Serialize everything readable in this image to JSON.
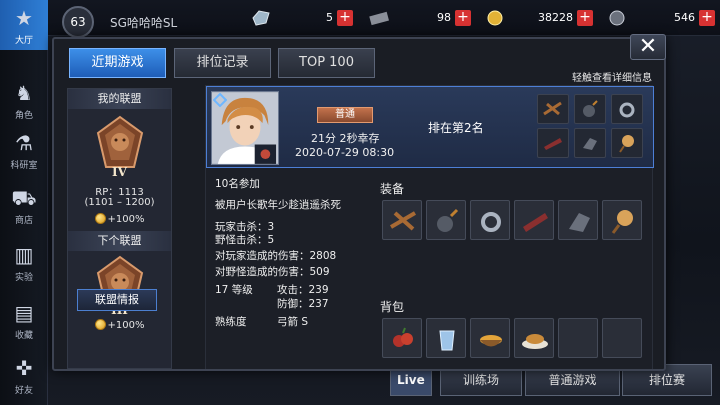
{
  "topbar": {
    "level": "63",
    "player_name": "SG哈哈哈SL",
    "resources": [
      {
        "icon": "diamond-icon",
        "amount": "5"
      },
      {
        "icon": "ticket-icon",
        "amount": "98"
      },
      {
        "icon": "gold-coin-icon",
        "amount": "38228"
      },
      {
        "icon": "bp-coin-icon",
        "amount": "546"
      }
    ],
    "plus": "+"
  },
  "sidebar": {
    "items": [
      {
        "label": "大厅",
        "icon": "star-icon"
      },
      {
        "label": "角色",
        "icon": "character-icon"
      },
      {
        "label": "科研室",
        "icon": "flask-icon"
      },
      {
        "label": "商店",
        "icon": "cart-icon"
      },
      {
        "label": "实验",
        "icon": "books-icon"
      },
      {
        "label": "收藏",
        "icon": "book-icon"
      },
      {
        "label": "好友",
        "icon": "gamepad-icon"
      }
    ]
  },
  "bottom": {
    "live": "Live",
    "training": "训练场",
    "normal_game": "普通游戏",
    "ranked": "排位赛"
  },
  "modal": {
    "tabs": [
      "近期游戏",
      "排位记录",
      "TOP 100"
    ],
    "active_tab": 0,
    "hint": "轻触查看详细信息",
    "close": "✕"
  },
  "league": {
    "my_title": "我的联盟",
    "my_rank": "IV",
    "rp": "RP：1113",
    "range": "(1101 – 1200)",
    "bonus": "+100%",
    "next_title": "下个联盟",
    "next_rank": "III",
    "next_bonus": "+100%",
    "info_button": "联盟情报"
  },
  "match": {
    "mode": "普通",
    "survival": "21分 2秒幸存",
    "datetime": "2020-07-29 08:30",
    "placement": "排在第2名",
    "participants": "10名参加",
    "killed_by": "被用户长歌年少趁逍遥杀死",
    "player_kills": "玩家击杀：3",
    "monster_kills": "野怪击杀：5",
    "player_damage": "对玩家造成的伤害：2808",
    "monster_damage": "对野怪造成的伤害：509",
    "level": "17 等级",
    "attack": "攻击：239",
    "defense": "防御：237",
    "proficiency_label": "熟练度",
    "proficiency_value": "弓箭 S",
    "equipment_title": "装备",
    "bag_title": "背包",
    "equipment": [
      "crossbow-icon",
      "bomb-icon",
      "ring-icon",
      "armor-icon",
      "gauntlet-icon",
      "pendant-icon"
    ],
    "bag": [
      "berry-icon",
      "glass-icon",
      "noodle-bowl-icon",
      "bread-plate-icon",
      "",
      ""
    ]
  },
  "colors": {
    "accent": "#2f7fd6",
    "panel": "#1a1d24",
    "bronze": "#a0623c",
    "plus_red": "#d73232"
  }
}
